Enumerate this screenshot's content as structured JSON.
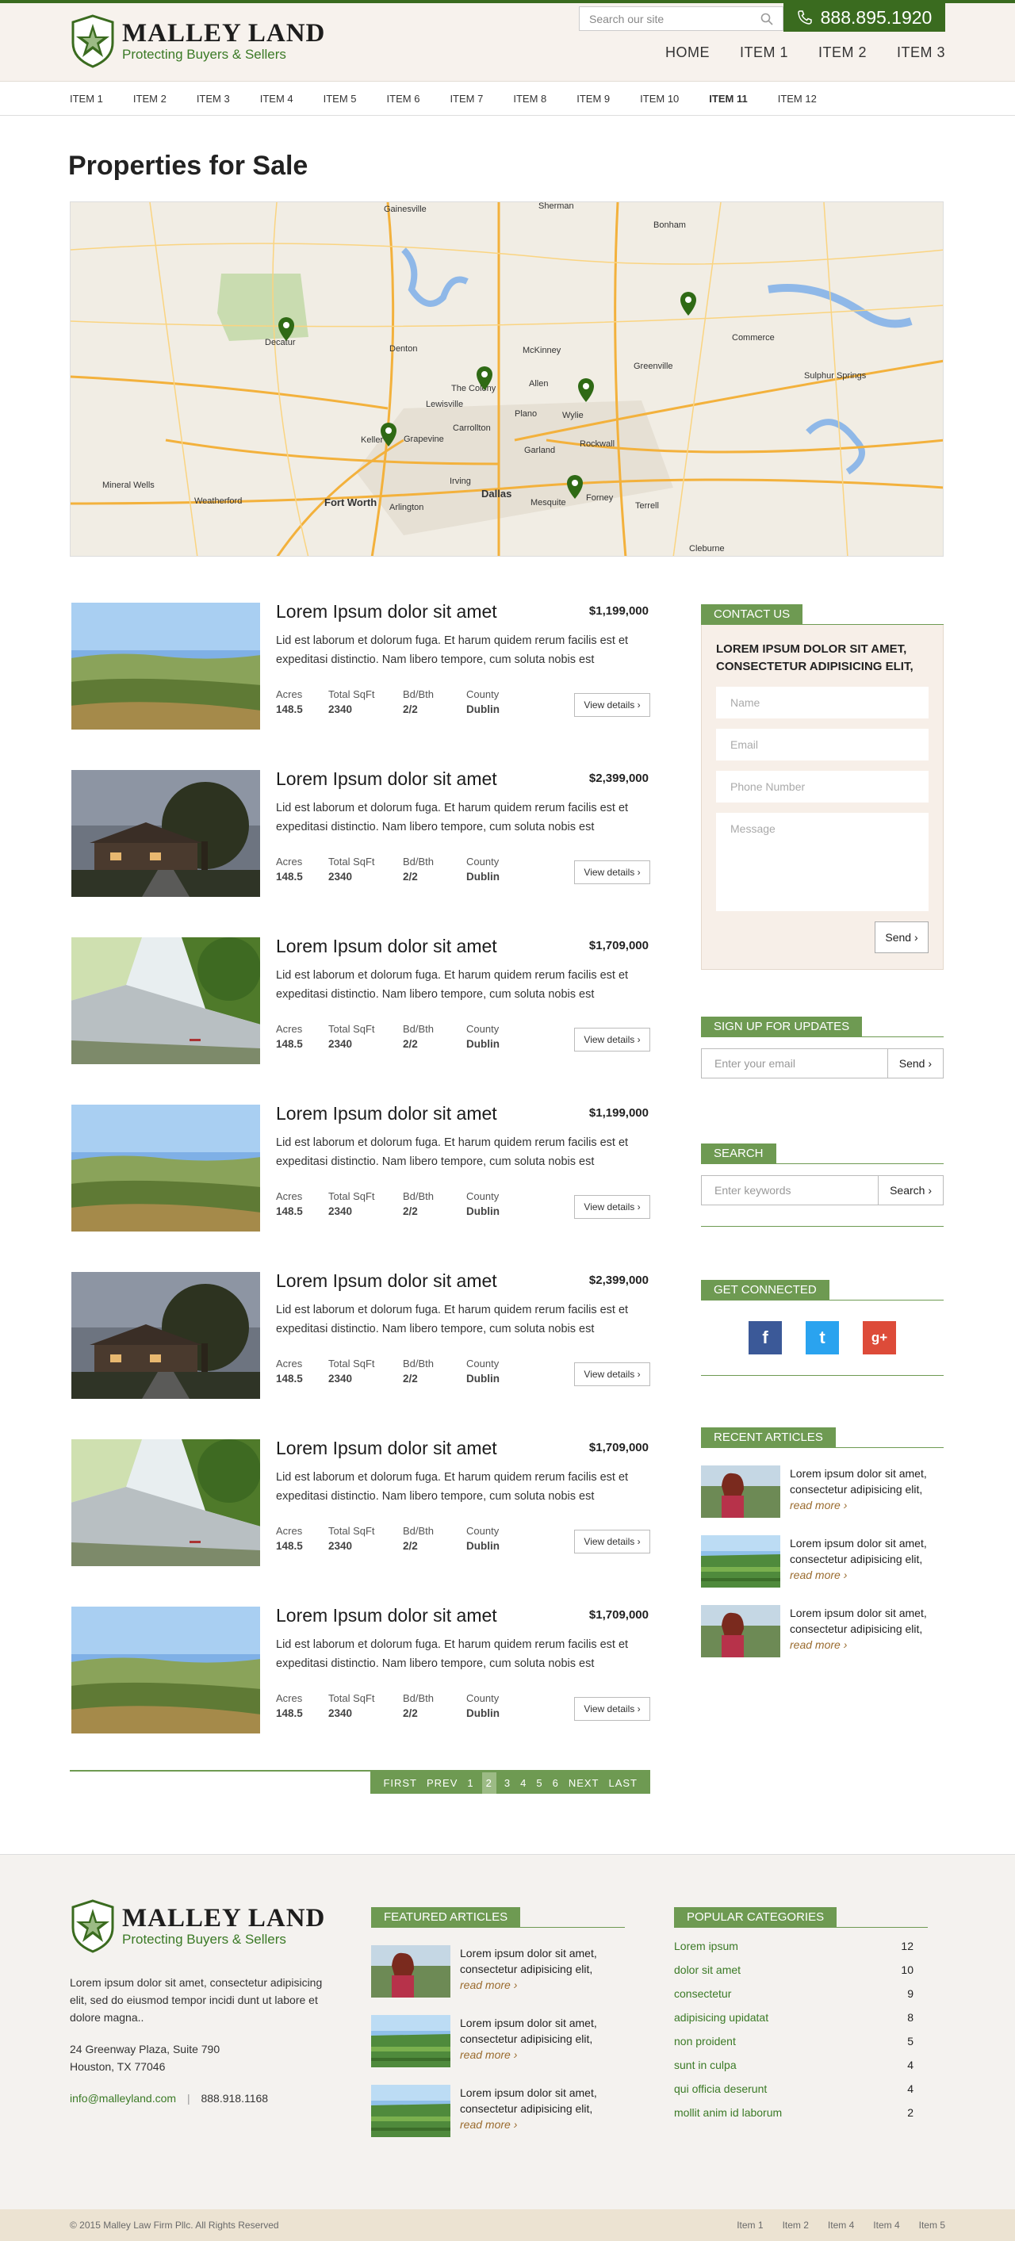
{
  "header": {
    "brand_name": "MALLEY LAND",
    "brand_tagline": "Protecting Buyers & Sellers",
    "search_placeholder": "Search our site",
    "phone": "888.895.1920",
    "nav": [
      "HOME",
      "ITEM 1",
      "ITEM 2",
      "ITEM 3"
    ]
  },
  "subnav": [
    "ITEM 1",
    "ITEM 2",
    "ITEM 3",
    "ITEM 4",
    "ITEM 5",
    "ITEM 6",
    "ITEM 7",
    "ITEM 8",
    "ITEM 9",
    "ITEM 10",
    "ITEM 11",
    "ITEM 12"
  ],
  "page_title": "Properties for Sale",
  "map": {
    "cities": [
      "Gainesville",
      "Sherman",
      "Bonham",
      "Decatur",
      "Denton",
      "McKinney",
      "Greenville",
      "Commerce",
      "Lewisville",
      "The Colony",
      "Allen",
      "Wylie",
      "Carrollton",
      "Plano",
      "Garland",
      "Rockwall",
      "Keller",
      "Grapevine",
      "Irving",
      "Fort Worth",
      "Arlington",
      "Dallas",
      "Mesquite",
      "Forney",
      "Weatherford",
      "Terrell",
      "Cleburne",
      "Sulphur Springs",
      "Mineral Wells"
    ]
  },
  "listings": [
    {
      "title": "Lorem Ipsum dolor sit amet",
      "price": "$1,199,000",
      "desc": "Lid est laborum et dolorum fuga. Et harum quidem rerum facilis est et expeditasi distinctio. Nam libero tempore, cum soluta nobis est",
      "acres": "148.5",
      "sqft": "2340",
      "bdbth": "2/2",
      "county": "Dublin",
      "img": "field"
    },
    {
      "title": "Lorem Ipsum dolor sit amet",
      "price": "$2,399,000",
      "desc": "Lid est laborum et dolorum fuga. Et harum quidem rerum facilis est et expeditasi distinctio. Nam libero tempore, cum soluta nobis est",
      "acres": "148.5",
      "sqft": "2340",
      "bdbth": "2/2",
      "county": "Dublin",
      "img": "house"
    },
    {
      "title": "Lorem Ipsum dolor sit amet",
      "price": "$1,709,000",
      "desc": "Lid est laborum et dolorum fuga. Et harum quidem rerum facilis est et expeditasi distinctio. Nam libero tempore, cum soluta nobis est",
      "acres": "148.5",
      "sqft": "2340",
      "bdbth": "2/2",
      "county": "Dublin",
      "img": "river"
    },
    {
      "title": "Lorem Ipsum dolor sit amet",
      "price": "$1,199,000",
      "desc": "Lid est laborum et dolorum fuga. Et harum quidem rerum facilis est et expeditasi distinctio. Nam libero tempore, cum soluta nobis est",
      "acres": "148.5",
      "sqft": "2340",
      "bdbth": "2/2",
      "county": "Dublin",
      "img": "field"
    },
    {
      "title": "Lorem Ipsum dolor sit amet",
      "price": "$2,399,000",
      "desc": "Lid est laborum et dolorum fuga. Et harum quidem rerum facilis est et expeditasi distinctio. Nam libero tempore, cum soluta nobis est",
      "acres": "148.5",
      "sqft": "2340",
      "bdbth": "2/2",
      "county": "Dublin",
      "img": "house"
    },
    {
      "title": "Lorem Ipsum dolor sit amet",
      "price": "$1,709,000",
      "desc": "Lid est laborum et dolorum fuga. Et harum quidem rerum facilis est et expeditasi distinctio. Nam libero tempore, cum soluta nobis est",
      "acres": "148.5",
      "sqft": "2340",
      "bdbth": "2/2",
      "county": "Dublin",
      "img": "river"
    },
    {
      "title": "Lorem Ipsum dolor sit amet",
      "price": "$1,709,000",
      "desc": "Lid est laborum et dolorum fuga. Et harum quidem rerum facilis est et expeditasi distinctio. Nam libero tempore, cum soluta nobis est",
      "acres": "148.5",
      "sqft": "2340",
      "bdbth": "2/2",
      "county": "Dublin",
      "img": "field"
    }
  ],
  "listing_labels": {
    "acres": "Acres",
    "sqft": "Total SqFt",
    "bdbth": "Bd/Bth",
    "county": "County",
    "view": "View details ›"
  },
  "pagination": {
    "first": "FIRST",
    "prev": "PREV",
    "pages": [
      "1",
      "2",
      "3",
      "4",
      "5",
      "6"
    ],
    "current": "2",
    "next": "NEXT",
    "last": "LAST"
  },
  "sidebar": {
    "contact": {
      "heading": "CONTACT US",
      "intro": "LOREM IPSUM DOLOR SIT AMET, CONSECTETUR ADIPISICING ELIT,",
      "name_ph": "Name",
      "email_ph": "Email",
      "phone_ph": "Phone Number",
      "message_ph": "Message",
      "send": "Send ›"
    },
    "signup": {
      "heading": "SIGN UP FOR UPDATES",
      "placeholder": "Enter your email",
      "button": "Send ›"
    },
    "search": {
      "heading": "SEARCH",
      "placeholder": "Enter keywords",
      "button": "Search ›"
    },
    "social": {
      "heading": "GET CONNECTED",
      "facebook": "f",
      "twitter": "t",
      "google": "g+"
    },
    "recent": {
      "heading": "RECENT ARTICLES",
      "items": [
        {
          "text": "Lorem ipsum dolor sit amet, consectetur adipisicing elit,",
          "more": "read more ›",
          "img": "person"
        },
        {
          "text": "Lorem ipsum dolor sit amet, consectetur adipisicing elit,",
          "more": "read more ›",
          "img": "farm"
        },
        {
          "text": "Lorem ipsum dolor sit amet, consectetur adipisicing elit,",
          "more": "read more ›",
          "img": "person"
        }
      ]
    }
  },
  "footer": {
    "brand_name": "MALLEY LAND",
    "brand_tagline": "Protecting Buyers & Sellers",
    "about": "Lorem ipsum dolor sit amet, consectetur adipisicing elit, sed do eiusmod tempor incidi dunt ut labore et dolore magna..",
    "address1": "24 Greenway Plaza, Suite 790",
    "address2": "Houston, TX 77046",
    "email": "info@malleyland.com",
    "phone": "888.918.1168",
    "featured": {
      "heading": "FEATURED ARTICLES",
      "items": [
        {
          "text": "Lorem ipsum dolor sit amet, consectetur adipisicing elit,",
          "more": "read more ›",
          "img": "person"
        },
        {
          "text": "Lorem ipsum dolor sit amet, consectetur adipisicing elit,",
          "more": "read more ›",
          "img": "farm"
        },
        {
          "text": "Lorem ipsum dolor sit amet, consectetur adipisicing elit,",
          "more": "read more ›",
          "img": "farm"
        }
      ]
    },
    "categories": {
      "heading": "POPULAR CATEGORIES",
      "items": [
        {
          "name": "Lorem ipsum",
          "count": "12"
        },
        {
          "name": "dolor sit amet",
          "count": "10"
        },
        {
          "name": "consectetur",
          "count": "9"
        },
        {
          "name": "adipisicing upidatat",
          "count": "8"
        },
        {
          "name": "non proident",
          "count": "5"
        },
        {
          "name": "sunt in culpa",
          "count": "4"
        },
        {
          "name": "qui officia deserunt",
          "count": "4"
        },
        {
          "name": "mollit anim id laborum",
          "count": "2"
        }
      ]
    },
    "copyright": "© 2015 Malley Law Firm Pllc. All Rights Reserved",
    "links": [
      "Item 1",
      "Item 2",
      "Item 4",
      "Item 4",
      "Item 5"
    ]
  }
}
